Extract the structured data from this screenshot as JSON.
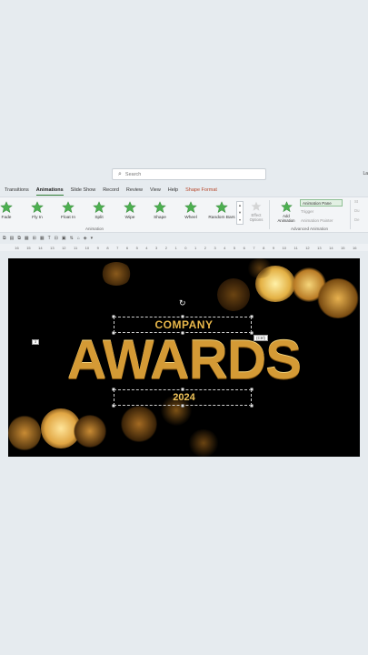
{
  "search": {
    "placeholder": "Search",
    "icon": "search-icon"
  },
  "user_initial": "La",
  "tabs": [
    {
      "label": "Transitions",
      "active": false
    },
    {
      "label": "Animations",
      "active": true
    },
    {
      "label": "Slide Show",
      "active": false
    },
    {
      "label": "Record",
      "active": false
    },
    {
      "label": "Review",
      "active": false
    },
    {
      "label": "View",
      "active": false
    },
    {
      "label": "Help",
      "active": false
    },
    {
      "label": "Shape Format",
      "active": false
    }
  ],
  "ribbon": {
    "animations": [
      "Fade",
      "Fly In",
      "Float In",
      "Split",
      "Wipe",
      "Shape",
      "Wheel",
      "Random Bars"
    ],
    "animation_group_label": "Animation",
    "effect_options_label": "Effect Options",
    "add_animation_label": "Add Animation",
    "animation_pane_label": "Animation Pane",
    "trigger_label": "Trigger",
    "animation_painter_label": "Animation Painter",
    "advanced_group_label": "Advanced Animation",
    "timing": [
      "St",
      "Du",
      "De"
    ]
  },
  "ruler_ticks": [
    "16",
    "15",
    "14",
    "13",
    "12",
    "11",
    "10",
    "9",
    "8",
    "7",
    "6",
    "5",
    "4",
    "3",
    "2",
    "1",
    "0",
    "1",
    "2",
    "3",
    "4",
    "5",
    "6",
    "7",
    "8",
    "9",
    "10",
    "11",
    "12",
    "13",
    "14",
    "15",
    "16"
  ],
  "slide": {
    "company": "COMPANY",
    "awards": "AWARDS",
    "year": "2024",
    "ctrl_tag": "(Ctrl)",
    "small_tag": "3"
  },
  "colors": {
    "accent": "#2e7d32",
    "gold": "#d49a35",
    "shape_format": "#b7472a"
  }
}
